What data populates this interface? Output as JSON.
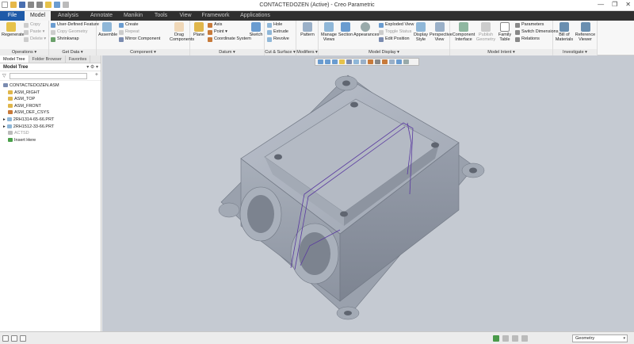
{
  "window": {
    "title": "CONTACTEDOZEN (Active) - Creo Parametric",
    "controls": [
      "—",
      "❐",
      "✕"
    ]
  },
  "qat_icons": [
    "new-icon",
    "open-icon",
    "save-icon",
    "undo-icon",
    "redo-icon",
    "regenerate-icon",
    "windows-icon",
    "close-icon"
  ],
  "tabs": [
    "File",
    "Model",
    "Analysis",
    "Annotate",
    "Manikin",
    "Tools",
    "View",
    "Framework",
    "Applications"
  ],
  "ribbon": {
    "operations": {
      "label": "Operations ▾",
      "regenerate": "Regenerate",
      "copy": "Copy",
      "paste": "Paste ▾",
      "delete": "Delete ▾"
    },
    "getdata": {
      "label": "Get Data ▾",
      "udf": "User-Defined Feature",
      "copy_geometry": "Copy Geometry",
      "shrinkwrap": "Shrinkwrap"
    },
    "component": {
      "label": "Component ▾",
      "assemble": "Assemble",
      "create": "Create",
      "repeat": "Repeat",
      "mirror": "Mirror Component",
      "drag": "Drag Components"
    },
    "datum": {
      "label": "Datum ▾",
      "plane": "Plane",
      "axis": "Axis",
      "point": "Point ▾",
      "csys": "Coordinate System",
      "sketch": "Sketch"
    },
    "cut": {
      "label": "Cut & Surface ▾",
      "hole": "Hole",
      "extrude": "Extrude",
      "revolve": "Revolve"
    },
    "modifiers": {
      "label": "Modifiers ▾",
      "pattern": "Pattern"
    },
    "display": {
      "label": "Model Display ▾",
      "manage_views": "Manage Views",
      "section": "Section",
      "appearances": "Appearances",
      "exploded": "Exploded View",
      "toggle": "Toggle Status",
      "edit_position": "Edit Position",
      "display_style": "Display Style",
      "perspective": "Perspective View"
    },
    "intent": {
      "label": "Model Intent ▾",
      "component_interface": "Component Interface",
      "publish": "Publish Geometry",
      "family": "Family Table",
      "parameters": "Parameters",
      "switch_dims": "Switch Dimensions",
      "relations": "Relations"
    },
    "investigate": {
      "label": "Investigate ▾",
      "bom": "Bill of Materials",
      "reference": "Reference Viewer"
    }
  },
  "panel": {
    "tabs": [
      "Model Tree",
      "Folder Browser",
      "Favorites"
    ],
    "title": "Model Tree",
    "filter_placeholder": "",
    "nodes": [
      {
        "label": "CONTACTEDOZEN.ASM",
        "color": "#7a8bb0",
        "indent": 0,
        "muted": false
      },
      {
        "label": "ASM_RIGHT",
        "color": "#e0b64a",
        "indent": 1,
        "muted": false
      },
      {
        "label": "ASM_TOP",
        "color": "#e0b64a",
        "indent": 1,
        "muted": false
      },
      {
        "label": "ASM_FRONT",
        "color": "#e0b64a",
        "indent": 1,
        "muted": false
      },
      {
        "label": "ASM_DEF_CSYS",
        "color": "#c77a3a",
        "indent": 1,
        "muted": false
      },
      {
        "label": "2RH1314-65-66.PRT",
        "color": "#8fb7d8",
        "indent": 0,
        "muted": false,
        "expander": true
      },
      {
        "label": "2RH1512-33-66.PRT",
        "color": "#8fb7d8",
        "indent": 0,
        "muted": false,
        "expander": true
      },
      {
        "label": "ACTSD",
        "color": "#bbbbbb",
        "indent": 1,
        "muted": true
      },
      {
        "label": "Insert Here",
        "color": "#4aa04a",
        "indent": 1,
        "muted": false
      }
    ]
  },
  "graphics_toolbar_icons": [
    "refit-icon",
    "zoom-in-icon",
    "zoom-out-icon",
    "repaint-icon",
    "orient-icon",
    "saved-views-icon",
    "display-style-icon",
    "datum-display-icon",
    "annotation-icon",
    "spin-center-icon",
    "perspective-icon",
    "section-icon",
    "appearance-icon"
  ],
  "status": {
    "filter": "Geometry"
  },
  "colors": {
    "file_tab": "#1e5aa8",
    "tab_bar": "#2f2f2f",
    "viewport": "#c5cad2",
    "model_body": "#a0a7b3",
    "sketch_lines": "#5a3aa0"
  }
}
